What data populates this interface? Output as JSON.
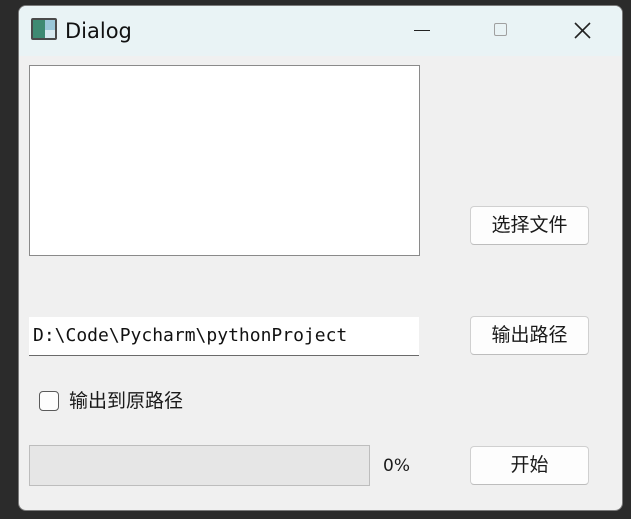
{
  "window": {
    "title": "Dialog",
    "controls": {
      "minimize_icon": "minimize-icon",
      "maximize_icon": "maximize-icon",
      "close_icon": "close-icon"
    },
    "icon": "app-icon"
  },
  "main": {
    "file_list": {
      "items": []
    },
    "select_file_button": "选择文件",
    "output_path": {
      "value": "D:\\Code\\Pycharm\\pythonProject"
    },
    "output_path_button": "输出路径",
    "output_to_original_checkbox": {
      "label": "输出到原路径",
      "checked": false
    },
    "progress": {
      "value": 0,
      "text": "0%"
    },
    "start_button": "开始"
  },
  "colors": {
    "titlebar": "#e9f3f5",
    "window_bg": "#f0f0f0",
    "button_bg": "#fdfdfd"
  }
}
